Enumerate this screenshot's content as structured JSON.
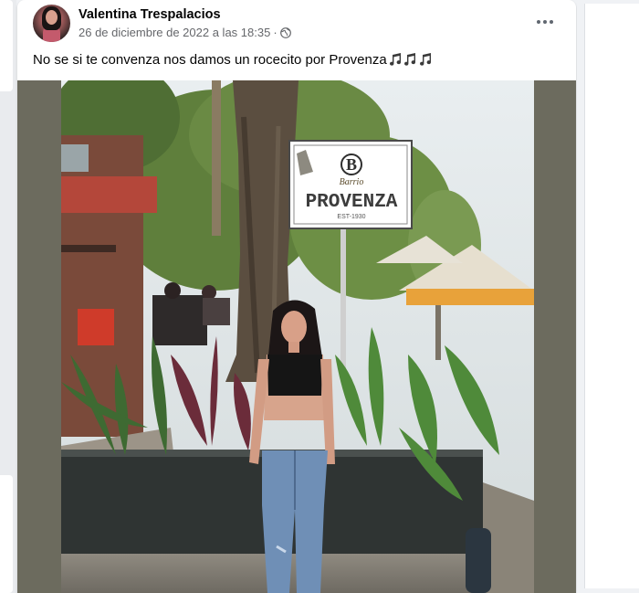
{
  "post": {
    "author": "Valentina Trespalacios",
    "timestamp": "26 de diciembre de 2022 a las 18:35",
    "separator": "·",
    "audience_icon": "globe-icon",
    "menu_icon": "more-horizontal-icon",
    "caption": "No se si te convenza nos damos un rocecito por Provenza",
    "caption_emoji": "musical-notes-icon",
    "photo": {
      "sign": {
        "top_text": "Barrio",
        "name": "PROVENZA",
        "est": "EST-1930",
        "logo_letter": "B"
      }
    }
  },
  "colors": {
    "text_primary": "#050505",
    "text_secondary": "#65676b",
    "background": "#f0f2f5",
    "card": "#ffffff"
  }
}
